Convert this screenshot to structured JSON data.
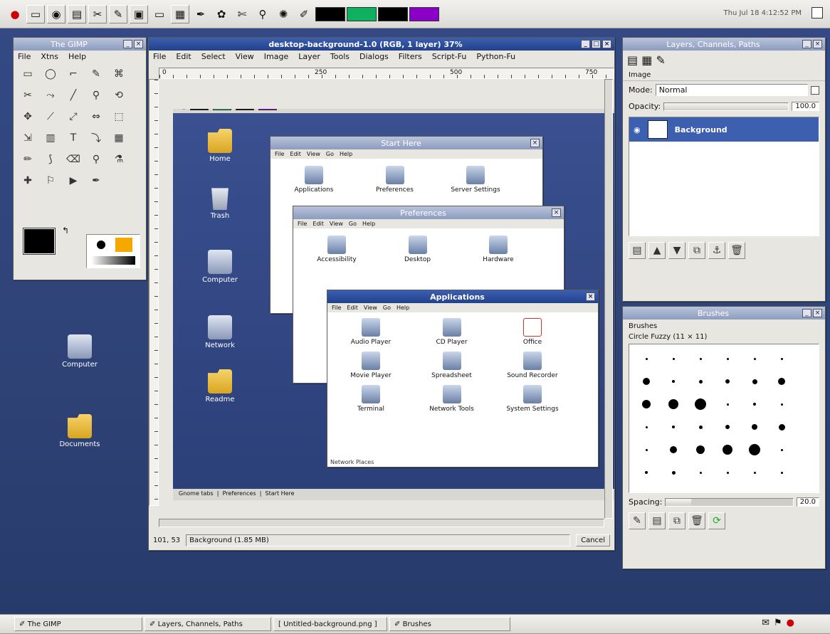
{
  "top_panel": {
    "launchers": [
      "redhat-icon",
      "terminal-icon",
      "web-icon",
      "files-icon",
      "tools-icon",
      "editor-icon",
      "image-icon",
      "notepad-icon",
      "screen-icon",
      "ooo-icon",
      "paint-icon",
      "cut-icon",
      "search-icon",
      "gimp-icon",
      "brush-icon"
    ],
    "swatches": [
      "#000000",
      "#0fb060",
      "#000000",
      "#8a00c8"
    ],
    "status_text": "Thu Jul 18  4:12:52 PM"
  },
  "toolbox": {
    "title": "The GIMP",
    "menu": [
      "File",
      "Xtns",
      "Help"
    ],
    "tool_glyphs": [
      "▭",
      "◯",
      "⌐",
      "✎",
      "⌘",
      "✂",
      "⤳",
      "╱",
      "⚲",
      "⟲",
      "✥",
      "⟋",
      "⤢",
      "⇔",
      "⬚",
      "⇲",
      "▥",
      "T",
      "⤵",
      "▦",
      "✏",
      "⟆",
      "⌫",
      "⚲",
      "⚗",
      "✚",
      "⚐",
      "▶",
      "✒"
    ],
    "fg_color": "#000000",
    "bg_color": "#ffffff"
  },
  "image_window": {
    "title": "desktop-background-1.0 (RGB, 1 layer) 37%",
    "menu": [
      "File",
      "Edit",
      "Select",
      "View",
      "Image",
      "Layer",
      "Tools",
      "Dialogs",
      "Filters",
      "Script-Fu",
      "Python-Fu"
    ],
    "ruler_marks": [
      "0",
      "250",
      "500",
      "750"
    ],
    "zoom": "37%",
    "status_text": "Background (1.85 MB)",
    "coords": "101, 53",
    "cancel": "Cancel",
    "bottom_tabs": [
      "Gnome tabs",
      "Preferences",
      "Start Here"
    ]
  },
  "inner_windows": {
    "start_here": {
      "title": "Start Here",
      "menu": [
        "File",
        "Edit",
        "View",
        "Go",
        "Help"
      ],
      "items": [
        "Applications",
        "Preferences",
        "Server Settings"
      ]
    },
    "preferences": {
      "title": "Preferences",
      "menu": [
        "File",
        "Edit",
        "View",
        "Go",
        "Help"
      ],
      "items": [
        "Accessibility",
        "Desktop",
        "Hardware"
      ]
    },
    "applications": {
      "title": "Applications",
      "menu": [
        "File",
        "Edit",
        "View",
        "Go",
        "Help"
      ],
      "items": [
        "Audio Player",
        "CD Player",
        "Office",
        "Movie Player",
        "Spreadsheet",
        "Sound Recorder",
        "Terminal",
        "Network Tools",
        "System Settings"
      ],
      "status": "Network Places"
    }
  },
  "desktop_icons_inner": [
    "Home",
    "Trash",
    "Computer",
    "Network",
    "Readme"
  ],
  "desktop_icons": [
    "Computer",
    "Documents"
  ],
  "layers_dialog": {
    "title": "Layers, Channels, Paths",
    "image_label": "Image",
    "mode_label": "Mode:",
    "mode_value": "Normal",
    "opacity_label": "Opacity:",
    "opacity_value": "100.0",
    "layer_name": "Background"
  },
  "brushes_dialog": {
    "title": "Brushes",
    "section": "Brushes",
    "brush_info": "Circle Fuzzy (11 × 11)",
    "spacing_label": "Spacing:",
    "spacing_value": "20.0"
  },
  "taskbar": {
    "items": [
      "The GIMP",
      "Layers, Channels, Paths",
      "[ Untitled-background.png ]",
      "Brushes"
    ]
  }
}
